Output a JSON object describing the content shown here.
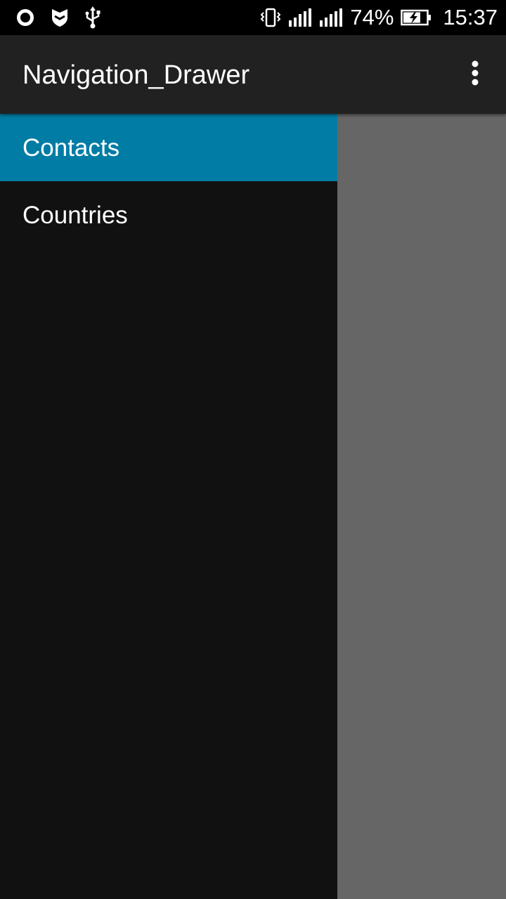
{
  "status_bar": {
    "battery_percent": "74%",
    "time": "15:37",
    "icons": [
      "opera-icon",
      "shield-icon",
      "usb-icon",
      "vibrate-icon",
      "signal-icon",
      "signal-icon",
      "battery-charging-icon"
    ]
  },
  "toolbar": {
    "title": "Navigation_Drawer",
    "overflow_icon": "more-vert-icon"
  },
  "drawer": {
    "items": [
      {
        "label": "Contacts",
        "selected": true
      },
      {
        "label": "Countries",
        "selected": false
      }
    ]
  },
  "colors": {
    "status_bar": "#000000",
    "toolbar": "#212121",
    "drawer_background": "#111111",
    "selected_item": "#017ca5",
    "scrim": "#666666",
    "text": "#ffffff"
  }
}
